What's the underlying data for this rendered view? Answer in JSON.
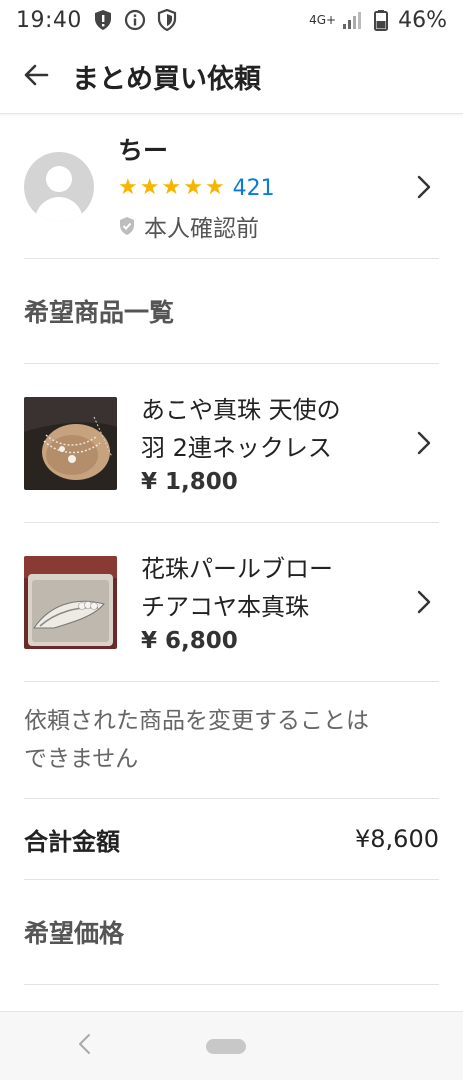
{
  "status_bar": {
    "time": "19:40",
    "network": "4G+",
    "battery": "46%",
    "icons": [
      "alert-shield-icon",
      "info-circle-icon",
      "shield-icon",
      "signal-icon",
      "battery-icon"
    ]
  },
  "app_bar": {
    "title": "まとめ買い依頼",
    "back_icon": "arrow-left-icon"
  },
  "user": {
    "name": "ちー",
    "stars": 5,
    "rating_count": "421",
    "verification": "本人確認前"
  },
  "products_section": {
    "title": "希望商品一覧",
    "items": [
      {
        "name_line1": "あこや真珠 天使の",
        "name_line2": "羽 2連ネックレス",
        "price": "¥ 1,800"
      },
      {
        "name_line1": "花珠パールブロー",
        "name_line2": "チアコヤ本真珠",
        "price": "¥ 6,800"
      }
    ]
  },
  "notice": {
    "line1": "依頼された商品を変更することは",
    "line2": "できません"
  },
  "total": {
    "label": "合計金額",
    "value": "¥8,600"
  },
  "desired_price": {
    "title": "希望価格"
  },
  "colors": {
    "star": "#f7b500",
    "link": "#0b7bd3",
    "divider": "#e3e3e3"
  }
}
